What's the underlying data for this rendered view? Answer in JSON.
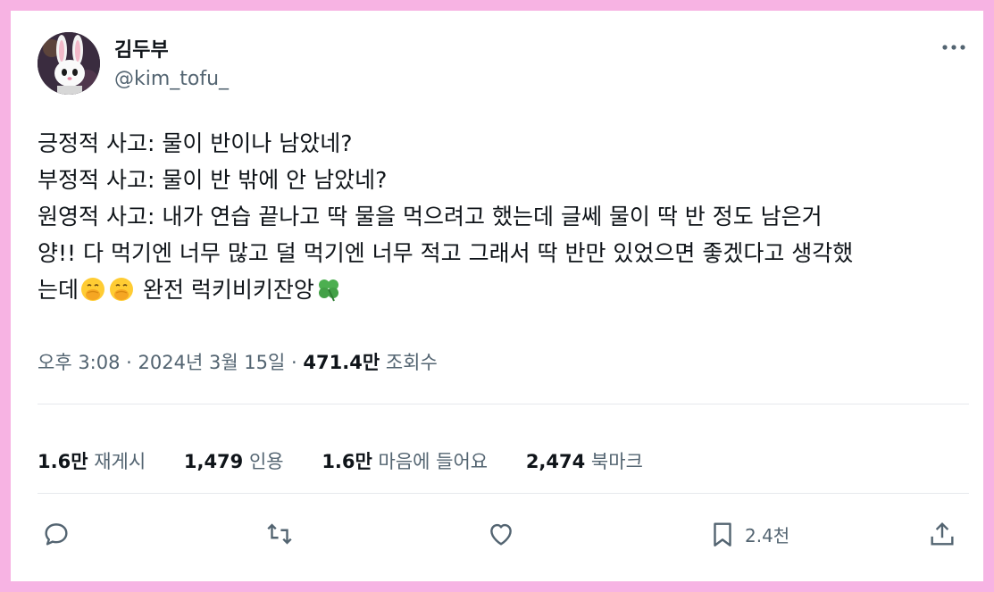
{
  "author": {
    "display_name": "김두부",
    "handle": "@kim_tofu_",
    "avatar_icon": "bunny-avatar-icon"
  },
  "tweet": {
    "lines": [
      "긍정적 사고: 물이 반이나 남았네?",
      "부정적 사고: 물이 반 밖에 안 남았네?",
      "원영적 사고: 내가 연습 끝나고 딱 물을 먹으려고 했는데 글쎄 물이 딱 반 정도 남은거",
      "양!! 다 먹기엔 너무 많고 덜 먹기엔 너무 적고 그래서 딱 반만 있었으면 좋겠다고 생각했"
    ],
    "last_line_prefix": "는데",
    "last_line_suffix": " 완전 럭키비키잔앙",
    "emojis": [
      "hand-over-mouth-emoji-icon",
      "four-leaf-clover-icon"
    ]
  },
  "meta": {
    "time": "오후 3:08",
    "separator": " · ",
    "date": "2024년 3월 15일",
    "views_count": "471.4만",
    "views_label": " 조회수"
  },
  "stats": [
    {
      "count": "1.6만",
      "label": " 재게시"
    },
    {
      "count": "1,479",
      "label": " 인용"
    },
    {
      "count": "1.6만",
      "label": " 마음에 들어요"
    },
    {
      "count": "2,474",
      "label": " 북마크"
    }
  ],
  "actions": {
    "icons": [
      "reply-icon",
      "retweet-icon",
      "like-icon",
      "bookmark-icon",
      "share-icon"
    ],
    "bookmark_count": "2.4천"
  },
  "colors": {
    "frame_border": "#f7b3e3",
    "text_primary": "#0f1419",
    "text_secondary": "#536471",
    "divider": "#e6e9ec"
  }
}
